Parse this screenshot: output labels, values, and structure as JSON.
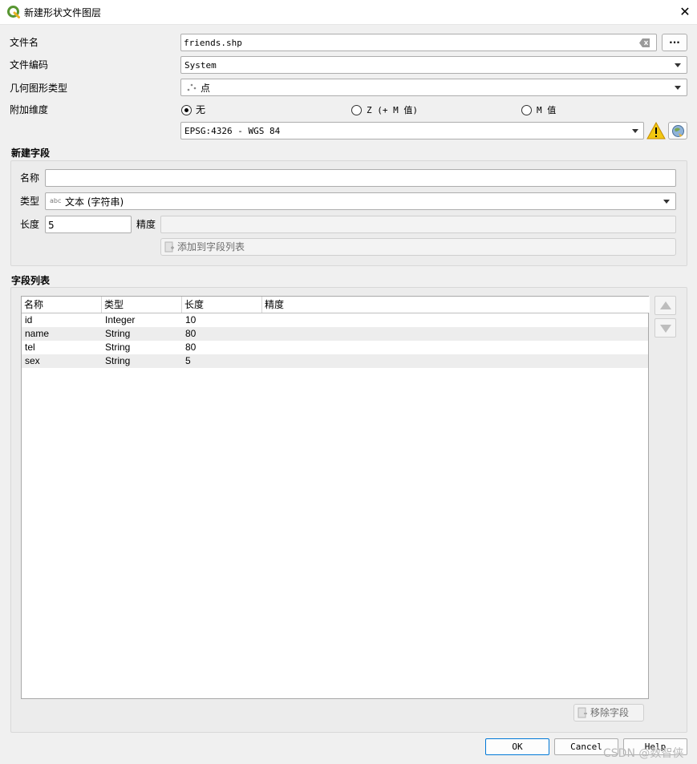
{
  "window": {
    "title": "新建形状文件图层",
    "close": "✕"
  },
  "form": {
    "filename_label": "文件名",
    "filename_value": "friends.shp",
    "browse_label": "···",
    "encoding_label": "文件编码",
    "encoding_value": "System",
    "geometry_label": "几何图形类型",
    "geometry_value": "点",
    "dimension_label": "附加维度",
    "dimension_options": [
      "无",
      "Z (+ M 值)",
      "M 值"
    ],
    "dimension_selected": "无",
    "crs_value": "EPSG:4326 - WGS 84"
  },
  "new_field": {
    "group_title": "新建字段",
    "name_label": "名称",
    "name_value": "",
    "type_label": "类型",
    "type_badge": "abc",
    "type_value": "文本 (字符串)",
    "length_label": "长度",
    "length_value": "5",
    "precision_label": "精度",
    "precision_value": "",
    "add_button": "添加到字段列表"
  },
  "field_list": {
    "group_title": "字段列表",
    "columns": [
      "名称",
      "类型",
      "长度",
      "精度"
    ],
    "rows": [
      {
        "name": "id",
        "type": "Integer",
        "length": "10",
        "precision": ""
      },
      {
        "name": "name",
        "type": "String",
        "length": "80",
        "precision": ""
      },
      {
        "name": "tel",
        "type": "String",
        "length": "80",
        "precision": ""
      },
      {
        "name": "sex",
        "type": "String",
        "length": "5",
        "precision": ""
      }
    ],
    "remove_button": "移除字段"
  },
  "footer": {
    "ok": "OK",
    "cancel": "Cancel",
    "help": "Help",
    "watermark": "CSDN @数智侠"
  },
  "colors": {
    "accent": "#0078d7",
    "qgis_green": "#589632",
    "warning": "#f2c811"
  }
}
